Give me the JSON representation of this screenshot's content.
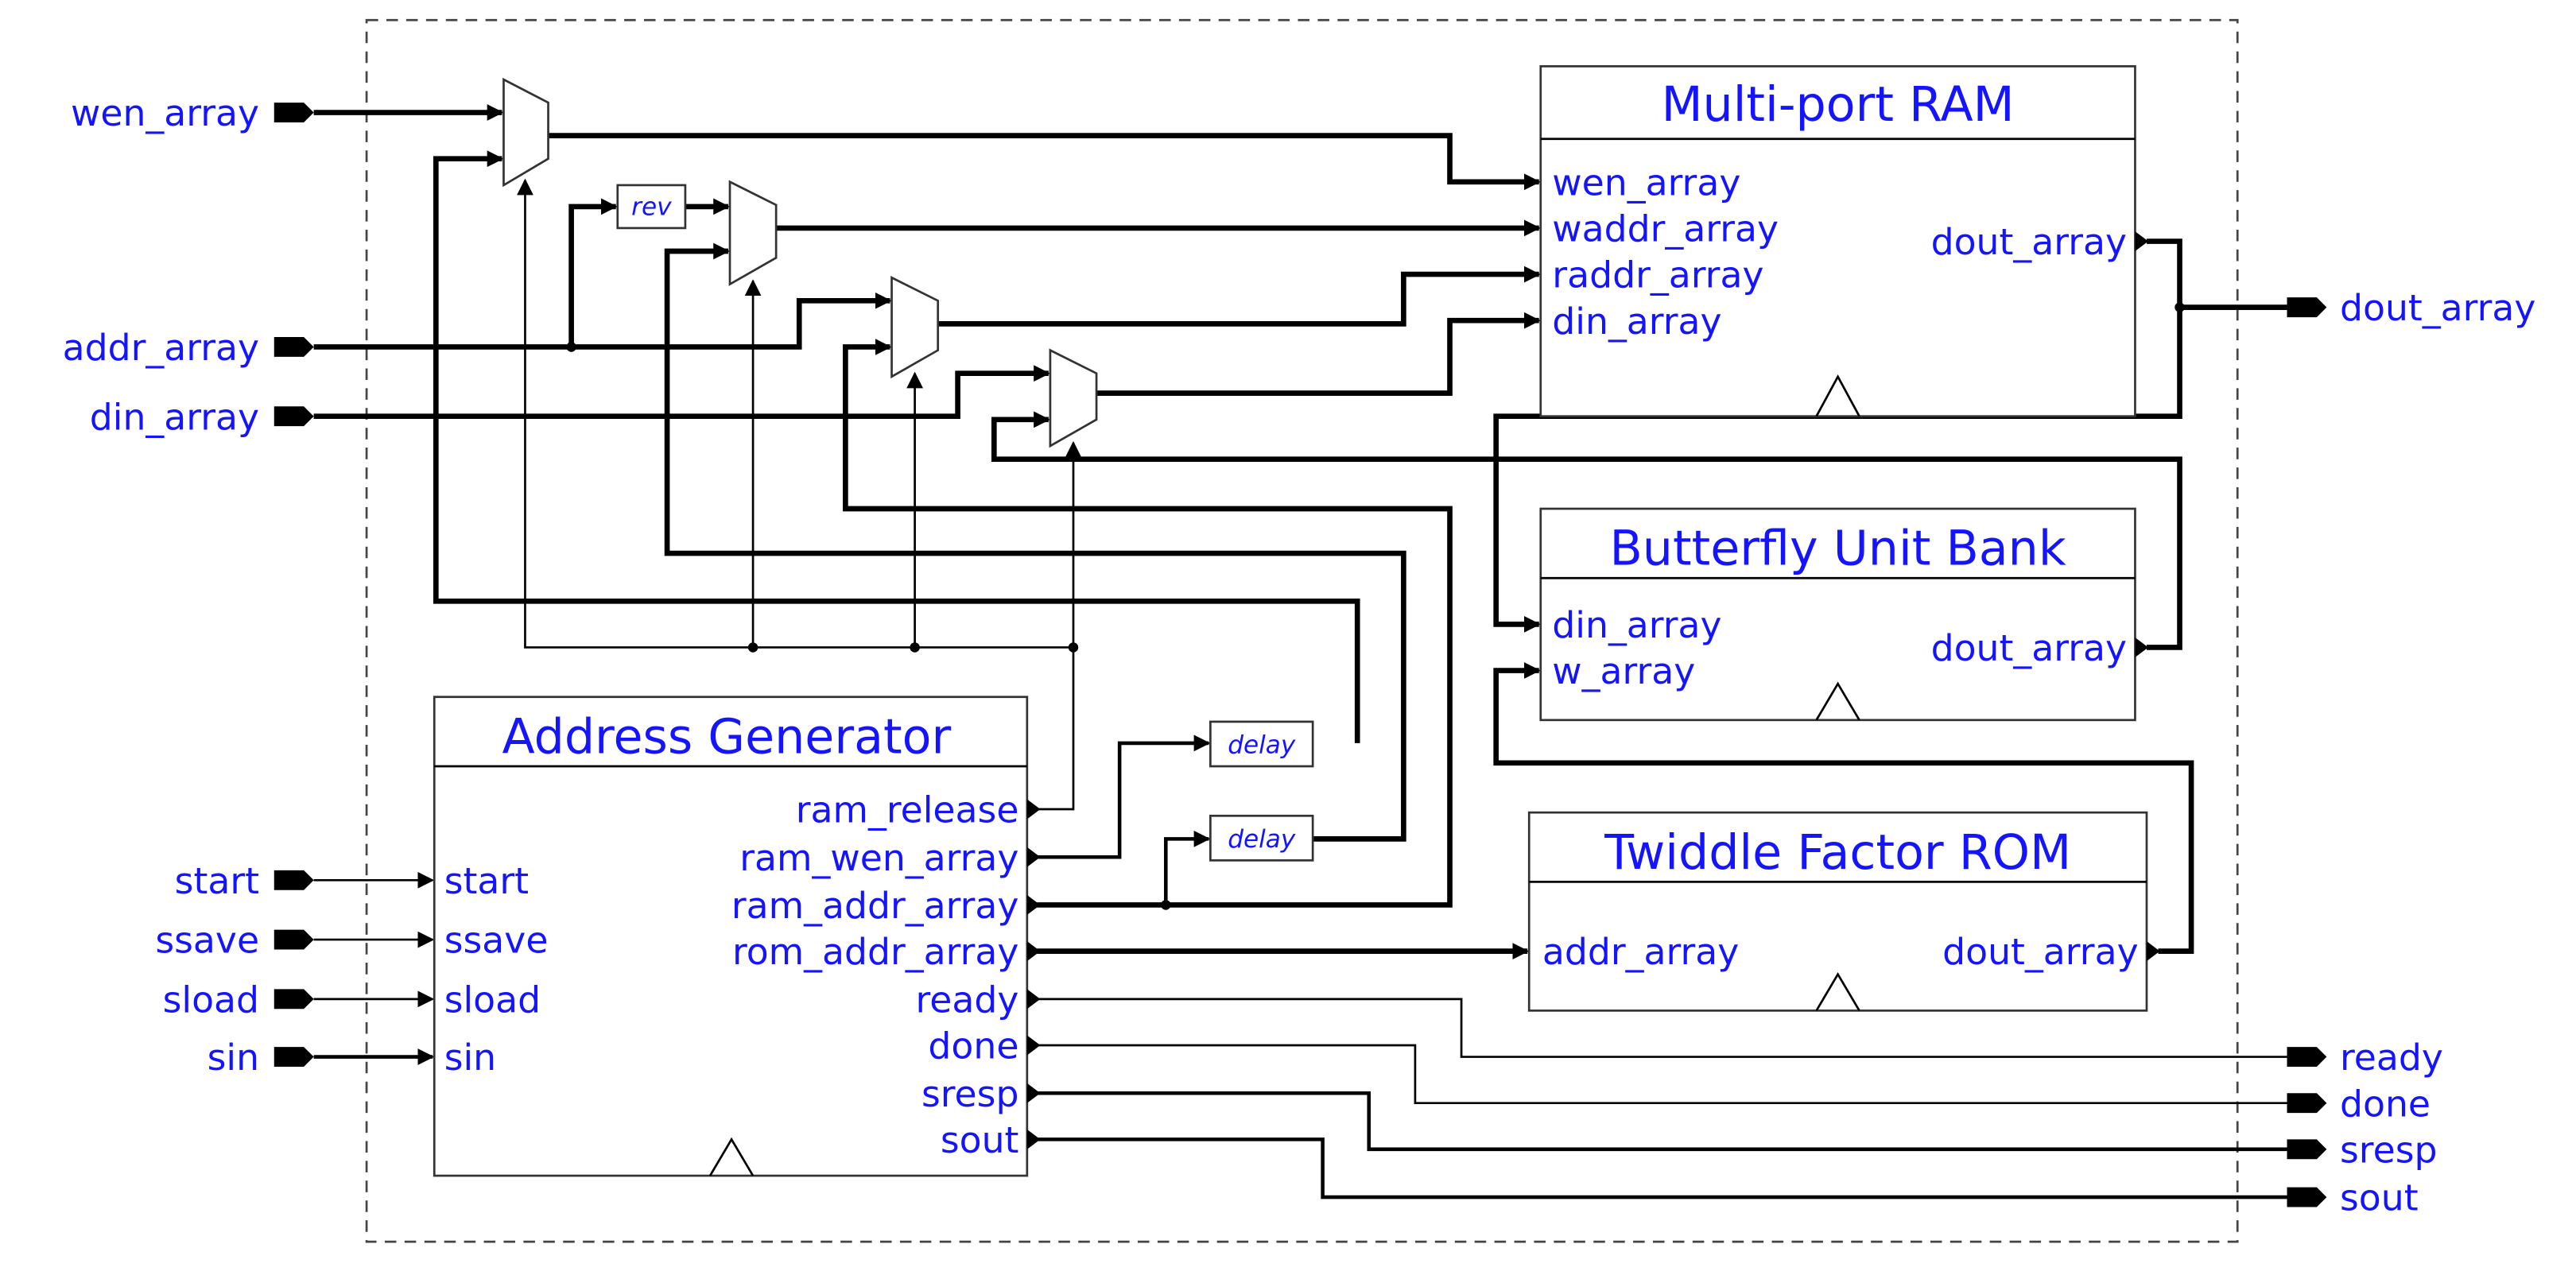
{
  "colors": {
    "label": "#1414ff",
    "wire": "#000000",
    "border": "#333333"
  },
  "inputs": {
    "wen_array": "wen_array",
    "addr_array": "addr_array",
    "din_array": "din_array",
    "start": "start",
    "ssave": "ssave",
    "sload": "sload",
    "sin": "sin"
  },
  "outputs": {
    "dout_array": "dout_array",
    "ready": "ready",
    "done": "done",
    "sresp": "sresp",
    "sout": "sout"
  },
  "ram": {
    "title": "Multi-port RAM",
    "in": [
      "wen_array",
      "waddr_array",
      "raddr_array",
      "din_array"
    ],
    "out": "dout_array"
  },
  "bub": {
    "title": "Butterfly Unit Bank",
    "in": [
      "din_array",
      "w_array"
    ],
    "out": "dout_array"
  },
  "tfr": {
    "title": "Twiddle Factor ROM",
    "in": "addr_array",
    "out": "dout_array"
  },
  "ag": {
    "title": "Address Generator",
    "in": [
      "start",
      "ssave",
      "sload",
      "sin"
    ],
    "out": [
      "ram_release",
      "ram_wen_array",
      "ram_addr_array",
      "rom_addr_array",
      "ready",
      "done",
      "sresp",
      "sout"
    ]
  },
  "rev": "rev",
  "delay": [
    "delay",
    "delay"
  ]
}
